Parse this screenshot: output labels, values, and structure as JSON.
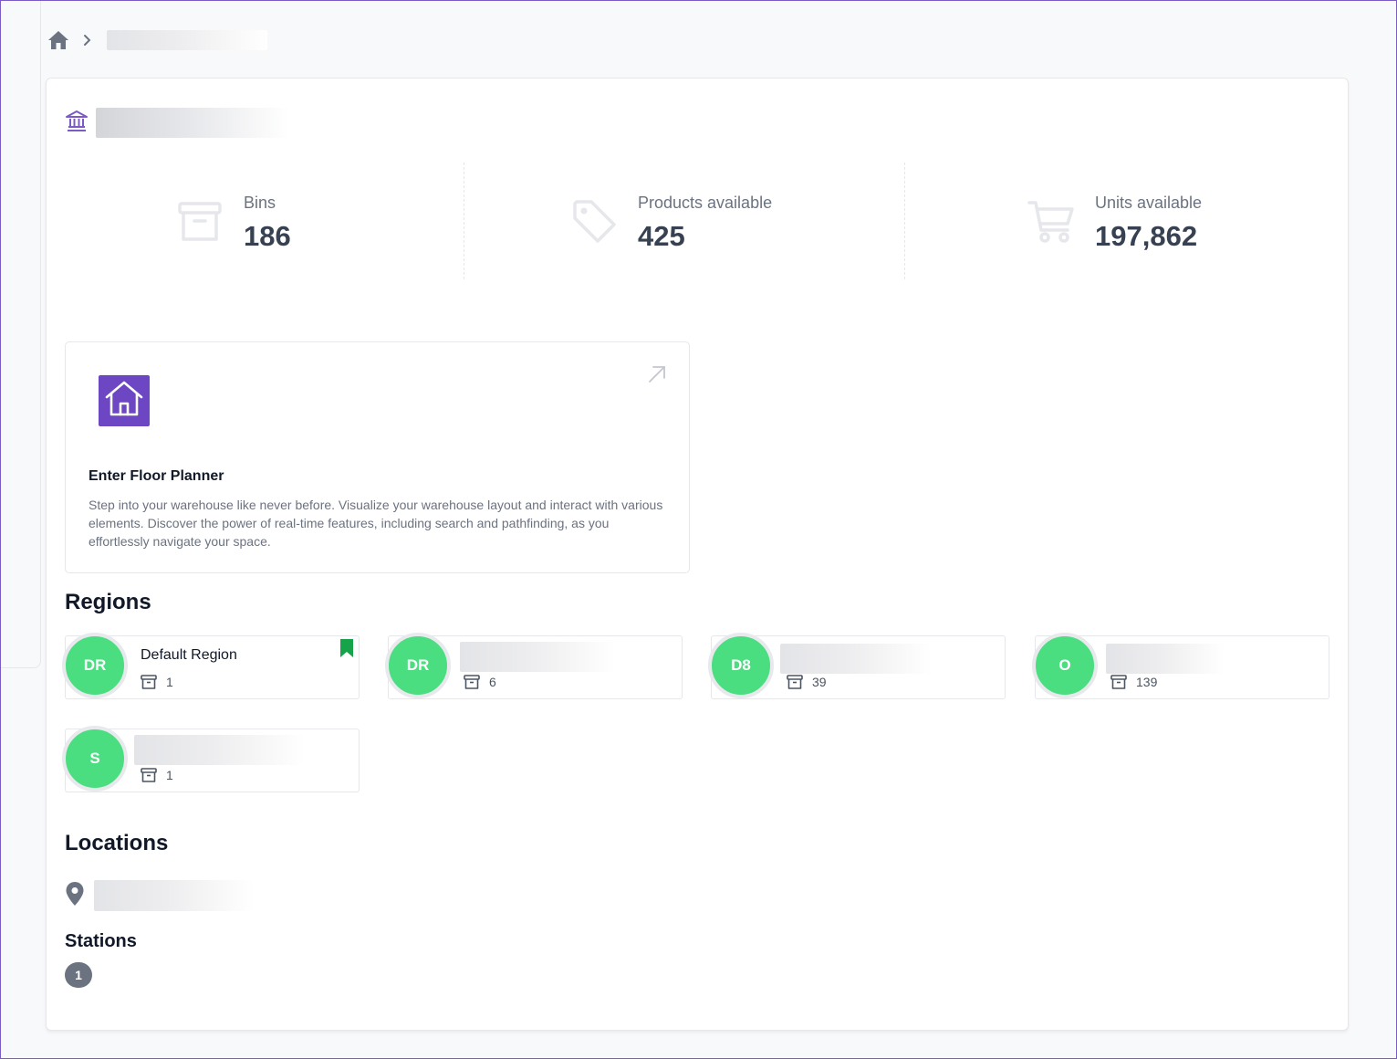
{
  "icons": {
    "home": "home-icon",
    "chevron": "chevron-right-icon",
    "warehouse": "warehouse-icon",
    "bins": "archive-box-icon",
    "products": "tag-icon",
    "units": "cart-icon",
    "planner": "house-icon",
    "open": "arrow-up-right-icon",
    "bookmark": "bookmark-icon",
    "location": "map-pin-icon"
  },
  "colors": {
    "accent": "#6d46c4",
    "avatar_green": "#4ade80",
    "bookmark_green": "#16a34a",
    "badge_gray": "#6b7280"
  },
  "stats": [
    {
      "label": "Bins",
      "value": "186"
    },
    {
      "label": "Products available",
      "value": "425"
    },
    {
      "label": "Units available",
      "value": "197,862"
    }
  ],
  "floor_planner": {
    "title": "Enter Floor Planner",
    "description": "Step into your warehouse like never before. Visualize your warehouse layout and interact with various elements. Discover the power of real-time features, including search and pathfinding, as you effortlessly navigate your space."
  },
  "regions_title": "Regions",
  "regions": [
    {
      "initials": "DR",
      "name": "Default Region",
      "bins": "1",
      "bookmarked": true
    },
    {
      "initials": "DR",
      "name": "",
      "bins": "6"
    },
    {
      "initials": "D8",
      "name": "",
      "bins": "39"
    },
    {
      "initials": "O",
      "name": "",
      "bins": "139"
    },
    {
      "initials": "S",
      "name": "",
      "bins": "1"
    }
  ],
  "locations_title": "Locations",
  "stations_title": "Stations",
  "stations_count": "1"
}
